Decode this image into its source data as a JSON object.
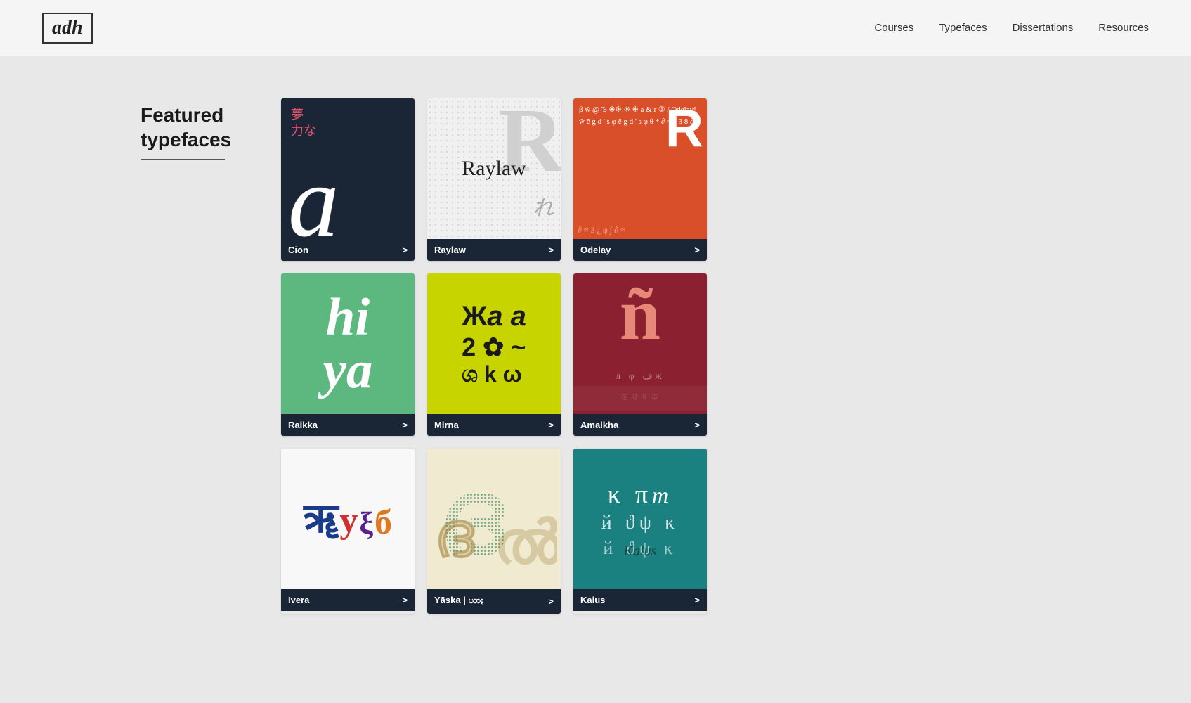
{
  "header": {
    "logo": "adh",
    "nav": [
      {
        "label": "Courses",
        "href": "#"
      },
      {
        "label": "Typefaces",
        "href": "#"
      },
      {
        "label": "Dissertations",
        "href": "#"
      },
      {
        "label": "Resources",
        "href": "#"
      }
    ]
  },
  "main": {
    "section_title_line1": "Featured",
    "section_title_line2": "typefaces",
    "cards": [
      {
        "id": "cion",
        "label": "Cion",
        "arrow": ">"
      },
      {
        "id": "raylaw",
        "label": "Raylaw",
        "arrow": ">"
      },
      {
        "id": "odelay",
        "label": "Odelay",
        "arrow": ">"
      },
      {
        "id": "raikka",
        "label": "Raikka",
        "arrow": ">"
      },
      {
        "id": "mirna",
        "label": "Mirna",
        "arrow": ">"
      },
      {
        "id": "amaikha",
        "label": "Amaikha",
        "arrow": ">"
      },
      {
        "id": "ivera",
        "label": "Ivera",
        "arrow": ">"
      },
      {
        "id": "yaska",
        "label": "Yāska | ယာႏ",
        "arrow": ">"
      },
      {
        "id": "kaius",
        "label": "Kaius",
        "arrow": ">"
      }
    ]
  }
}
